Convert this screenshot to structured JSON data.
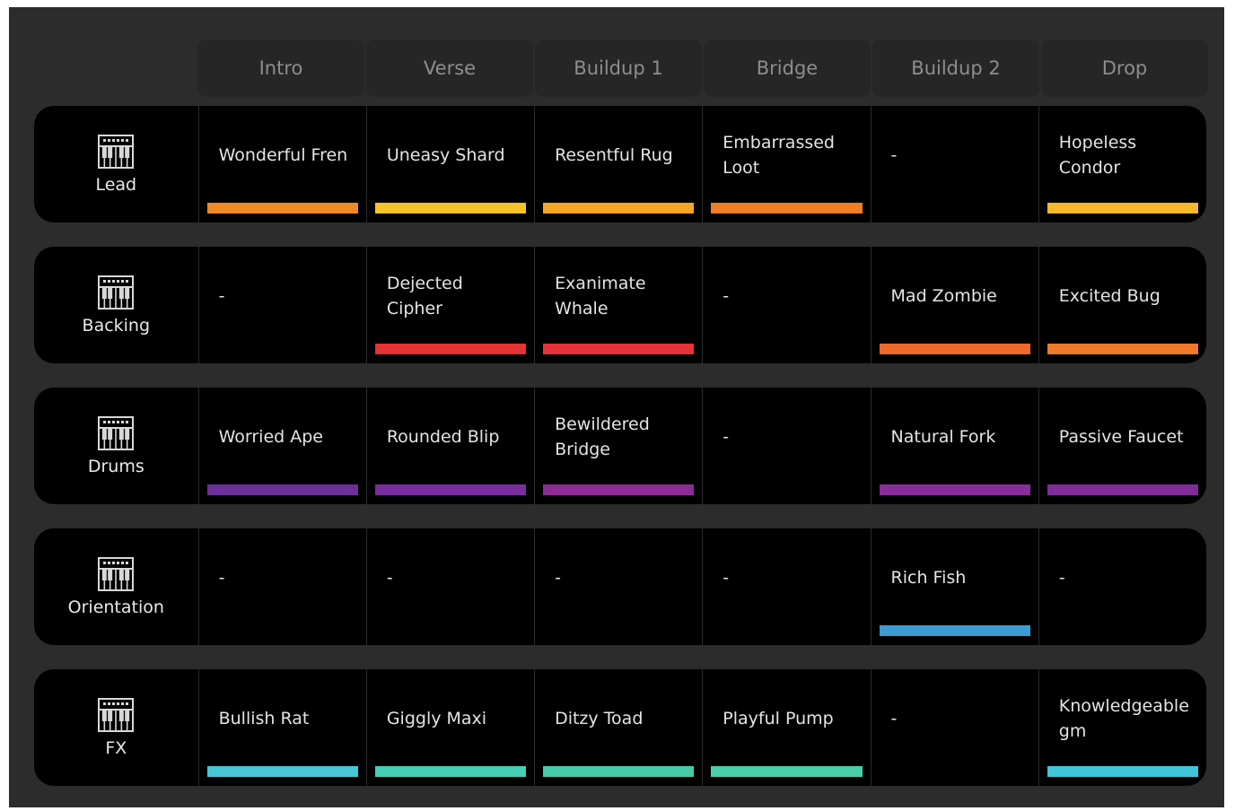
{
  "sections": [
    "Intro",
    "Verse",
    "Buildup 1",
    "Bridge",
    "Buildup 2",
    "Drop"
  ],
  "tracks": [
    {
      "name": "Lead",
      "icon": "keyboard-icon",
      "clips": [
        {
          "name": "Wonderful Fren",
          "color": "#f08a24"
        },
        {
          "name": "Uneasy Shard",
          "color": "#f7c32a"
        },
        {
          "name": "Resentful Rug",
          "color": "#f5a623"
        },
        {
          "name": "Embarrassed Loot",
          "color": "#ef7d22"
        },
        {
          "name": "-",
          "color": null
        },
        {
          "name": "Hopeless Condor",
          "color": "#f7b82a"
        }
      ]
    },
    {
      "name": "Backing",
      "icon": "keyboard-icon",
      "clips": [
        {
          "name": "-",
          "color": null
        },
        {
          "name": "Dejected Cipher",
          "color": "#e63232"
        },
        {
          "name": "Exanimate Whale",
          "color": "#e8323a"
        },
        {
          "name": "-",
          "color": null
        },
        {
          "name": "Mad Zombie",
          "color": "#ec6a2c"
        },
        {
          "name": "Excited Bug",
          "color": "#ee7a2a"
        }
      ]
    },
    {
      "name": "Drums",
      "icon": "keyboard-icon",
      "clips": [
        {
          "name": "Worried Ape",
          "color": "#6d2f9a"
        },
        {
          "name": "Rounded Blip",
          "color": "#7a2d9e"
        },
        {
          "name": "Bewildered Bridge",
          "color": "#8e2c96"
        },
        {
          "name": "-",
          "color": null
        },
        {
          "name": "Natural Fork",
          "color": "#8a2d9c"
        },
        {
          "name": "Passive Faucet",
          "color": "#822c9a"
        }
      ]
    },
    {
      "name": "Orientation",
      "icon": "keyboard-icon",
      "clips": [
        {
          "name": "-",
          "color": null
        },
        {
          "name": "-",
          "color": null
        },
        {
          "name": "-",
          "color": null
        },
        {
          "name": "-",
          "color": null
        },
        {
          "name": "Rich Fish",
          "color": "#3a9bd5"
        },
        {
          "name": "-",
          "color": null
        }
      ]
    },
    {
      "name": "FX",
      "icon": "keyboard-icon",
      "clips": [
        {
          "name": "Bullish Rat",
          "color": "#47c7d6"
        },
        {
          "name": "Giggly Maxi",
          "color": "#45cfb6"
        },
        {
          "name": "Ditzy Toad",
          "color": "#46cbaa"
        },
        {
          "name": "Playful Pump",
          "color": "#49cfa8"
        },
        {
          "name": "-",
          "color": null
        },
        {
          "name": "Knowledgeable gm",
          "color": "#3fc6d8"
        }
      ]
    }
  ],
  "colors": {
    "panel_bg": "#2c2c2c",
    "row_bg": "#000000",
    "header_bg": "#262626",
    "header_text": "#8e8e8e",
    "text": "#e4e4e4"
  }
}
